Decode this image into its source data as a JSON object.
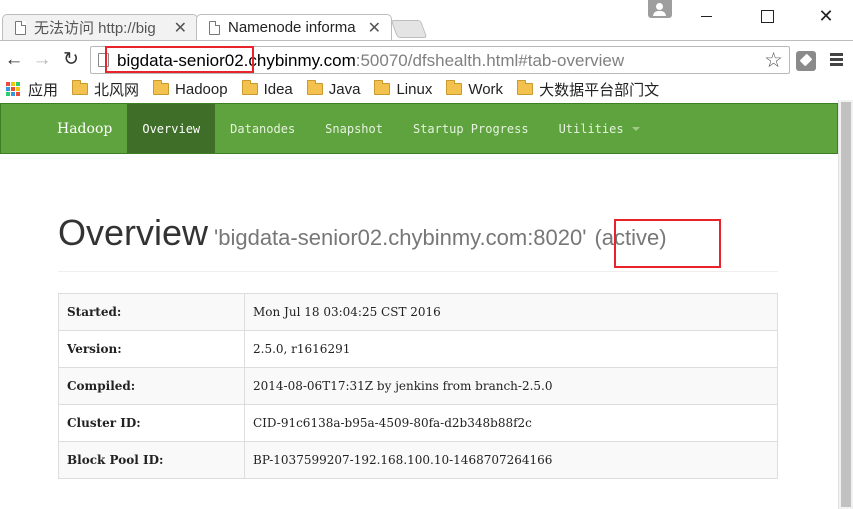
{
  "browser": {
    "tabs": [
      {
        "title": "无法访问 http://big"
      },
      {
        "title": "Namenode informa"
      }
    ],
    "url_host": "bigdata-senior02.chybinmy.com",
    "url_rest": ":50070/dfshealth.html#tab-overview",
    "bookmarks": [
      {
        "label": "应用",
        "icon": "apps-icon"
      },
      {
        "label": "北风网",
        "icon": "folder-icon"
      },
      {
        "label": "Hadoop",
        "icon": "folder-icon"
      },
      {
        "label": "Idea",
        "icon": "folder-icon"
      },
      {
        "label": "Java",
        "icon": "folder-icon"
      },
      {
        "label": "Linux",
        "icon": "folder-icon"
      },
      {
        "label": "Work",
        "icon": "folder-icon"
      },
      {
        "label": "大数据平台部门文",
        "icon": "folder-icon"
      }
    ]
  },
  "navbar": {
    "brand": "Hadoop",
    "items": [
      "Overview",
      "Datanodes",
      "Snapshot",
      "Startup Progress",
      "Utilities"
    ],
    "active": "Overview",
    "color": "#5fa33e"
  },
  "overview": {
    "title": "Overview",
    "host": "'bigdata-senior02.chybinmy.com:8020'",
    "state": "(active)"
  },
  "info": [
    {
      "label": "Started:",
      "value": "Mon Jul 18 03:04:25 CST 2016"
    },
    {
      "label": "Version:",
      "value": "2.5.0, r1616291"
    },
    {
      "label": "Compiled:",
      "value": "2014-08-06T17:31Z by jenkins from branch-2.5.0"
    },
    {
      "label": "Cluster ID:",
      "value": "CID-91c6138a-b95a-4509-80fa-d2b348b88f2c"
    },
    {
      "label": "Block Pool ID:",
      "value": "BP-1037599207-192.168.100.10-1468707264166"
    }
  ],
  "highlight_color": "#e8232a"
}
